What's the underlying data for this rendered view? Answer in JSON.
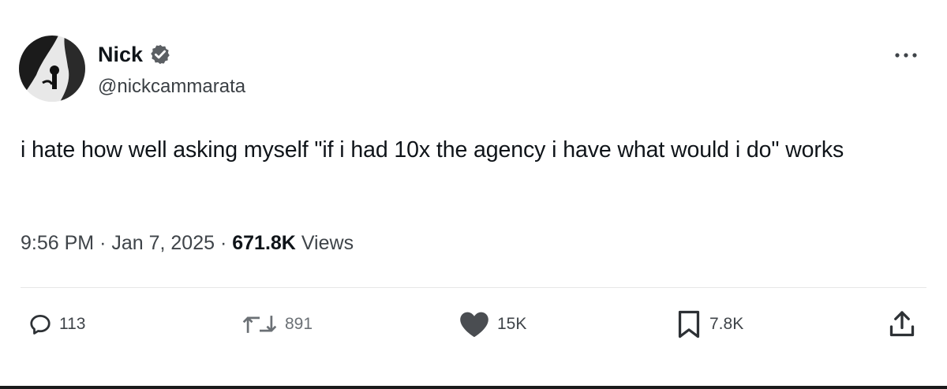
{
  "user": {
    "display_name": "Nick",
    "handle": "@nickcammarata",
    "verified_icon": "verified-badge-icon",
    "avatar_icon": "profile-avatar"
  },
  "tweet": {
    "text": "i hate how well asking myself \"if i had 10x the agency i have what would i do\" works"
  },
  "meta": {
    "time": "9:56 PM",
    "separator": "·",
    "date": "Jan 7, 2025",
    "views_count": "671.8K",
    "views_label": "Views"
  },
  "actions": {
    "replies": "113",
    "reposts": "891",
    "likes": "15K",
    "bookmarks": "7.8K"
  },
  "icons": {
    "more": "more-dots-icon",
    "reply": "reply-bubble-icon",
    "repost": "repost-arrows-icon",
    "like": "heart-icon",
    "bookmark": "bookmark-icon",
    "share": "share-upload-icon"
  },
  "colors": {
    "text_primary": "#0f1419",
    "text_secondary": "#3f4449",
    "background": "#ffffff"
  }
}
